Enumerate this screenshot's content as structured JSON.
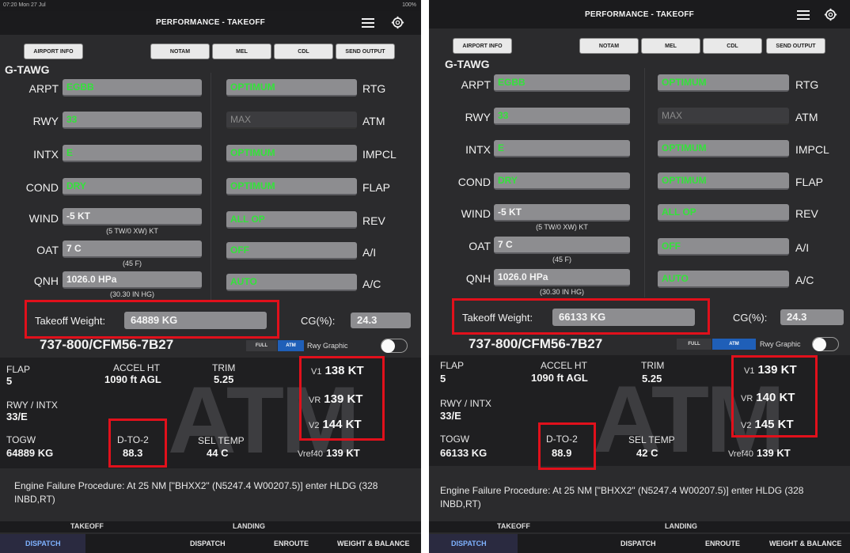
{
  "left": {
    "status": {
      "time": "07:20 Mon 27 Jul",
      "battery": "100%"
    },
    "title": "PERFORMANCE - TAKEOFF",
    "buttons": [
      "AIRPORT INFO",
      "NOTAM",
      "MEL",
      "CDL",
      "SEND OUTPUT"
    ],
    "registration": "G-TAWG",
    "left_fields": [
      {
        "label": "ARPT",
        "value": "EGBB",
        "sub": ""
      },
      {
        "label": "RWY",
        "value": "33",
        "sub": ""
      },
      {
        "label": "INTX",
        "value": "E",
        "sub": ""
      },
      {
        "label": "COND",
        "value": "DRY",
        "sub": ""
      },
      {
        "label": "WIND",
        "value": "-5 KT",
        "sub": "(5 TW/0 XW) KT"
      },
      {
        "label": "OAT",
        "value": "7 C",
        "sub": "(45 F)"
      },
      {
        "label": "QNH",
        "value": "1026.0 HPa",
        "sub": "(30.30 IN HG)"
      }
    ],
    "right_fields": [
      {
        "value": "OPTIMUM",
        "label": "RTG"
      },
      {
        "value": "MAX",
        "label": "ATM"
      },
      {
        "value": "OPTIMUM",
        "label": "IMPCL"
      },
      {
        "value": "OPTIMUM",
        "label": "FLAP"
      },
      {
        "value": "ALL OP",
        "label": "REV"
      },
      {
        "value": "OFF",
        "label": "A/I"
      },
      {
        "value": "AUTO",
        "label": "A/C"
      }
    ],
    "takeoff_weight_label": "Takeoff Weight:",
    "takeoff_weight": "64889 KG",
    "cg_label": "CG(%):",
    "cg": "24.3",
    "aircraft": "737-800/CFM56-7B27",
    "seg_full": "FULL",
    "seg_atm": "ATM",
    "rwy_graphic": "Rwy Graphic",
    "watermark": "ATM",
    "results": {
      "flap_h": "FLAP",
      "flap": "5",
      "accel_h": "ACCEL HT",
      "accel": "1090 ft AGL",
      "trim_h": "TRIM",
      "trim": "5.25",
      "rwy_h": "RWY / INTX",
      "rwy": "33/E",
      "togw_h": "TOGW",
      "togw": "64889 KG",
      "dto2_h": "D-TO-2",
      "dto2": "88.3",
      "seltemp_h": "SEL TEMP",
      "seltemp": "44 C",
      "v1_h": "V1",
      "v1": "138 KT",
      "vr_h": "VR",
      "vr": "139 KT",
      "v2_h": "V2",
      "v2": "144 KT",
      "vref_h": "Vref40",
      "vref": "139 KT"
    },
    "efp": "Engine Failure Procedure: At 25 NM [\"BHXX2\" (N5247.4 W00207.5)] enter HLDG (328 INBD,RT)",
    "tab_takeoff": "TAKEOFF",
    "tab_landing": "LANDING",
    "bottom_tabs": [
      "DISPATCH",
      "DISPATCH",
      "ENROUTE",
      "WEIGHT & BALANCE"
    ]
  },
  "right": {
    "title": "PERFORMANCE - TAKEOFF",
    "buttons": [
      "AIRPORT INFO",
      "NOTAM",
      "MEL",
      "CDL",
      "SEND OUTPUT"
    ],
    "registration": "G-TAWG",
    "left_fields": [
      {
        "label": "ARPT",
        "value": "EGBB",
        "sub": ""
      },
      {
        "label": "RWY",
        "value": "33",
        "sub": ""
      },
      {
        "label": "INTX",
        "value": "E",
        "sub": ""
      },
      {
        "label": "COND",
        "value": "DRY",
        "sub": ""
      },
      {
        "label": "WIND",
        "value": "-5 KT",
        "sub": "(5 TW/0 XW) KT"
      },
      {
        "label": "OAT",
        "value": "7 C",
        "sub": "(45 F)"
      },
      {
        "label": "QNH",
        "value": "1026.0 HPa",
        "sub": "(30.30 IN HG)"
      }
    ],
    "right_fields": [
      {
        "value": "OPTIMUM",
        "label": "RTG"
      },
      {
        "value": "MAX",
        "label": "ATM"
      },
      {
        "value": "OPTIMUM",
        "label": "IMPCL"
      },
      {
        "value": "OPTIMUM",
        "label": "FLAP"
      },
      {
        "value": "ALL OP",
        "label": "REV"
      },
      {
        "value": "OFF",
        "label": "A/I"
      },
      {
        "value": "AUTO",
        "label": "A/C"
      }
    ],
    "takeoff_weight_label": "Takeoff Weight:",
    "takeoff_weight": "66133 KG",
    "cg_label": "CG(%):",
    "cg": "24.3",
    "aircraft": "737-800/CFM56-7B27",
    "seg_full": "FULL",
    "seg_atm": "ATM",
    "rwy_graphic": "Rwy Graphic",
    "watermark": "ATM",
    "results": {
      "flap_h": "FLAP",
      "flap": "5",
      "accel_h": "ACCEL HT",
      "accel": "1090 ft AGL",
      "trim_h": "TRIM",
      "trim": "5.25",
      "rwy_h": "RWY / INTX",
      "rwy": "33/E",
      "togw_h": "TOGW",
      "togw": "66133 KG",
      "dto2_h": "D-TO-2",
      "dto2": "88.9",
      "seltemp_h": "SEL TEMP",
      "seltemp": "42 C",
      "v1_h": "V1",
      "v1": "139 KT",
      "vr_h": "VR",
      "vr": "140 KT",
      "v2_h": "V2",
      "v2": "145 KT",
      "vref_h": "Vref40",
      "vref": "139 KT"
    },
    "efp": "Engine Failure Procedure: At 25 NM [\"BHXX2\" (N5247.4 W00207.5)] enter HLDG (328 INBD,RT)",
    "tab_takeoff": "TAKEOFF",
    "tab_landing": "LANDING",
    "bottom_tabs": [
      "DISPATCH",
      "DISPATCH",
      "ENROUTE",
      "WEIGHT & BALANCE"
    ]
  },
  "colors": {
    "background": "#2b2b2d",
    "field_value_green": "#33e33a",
    "highlight_red": "#e1101b",
    "atm_segment_blue": "#1f5fb8"
  }
}
